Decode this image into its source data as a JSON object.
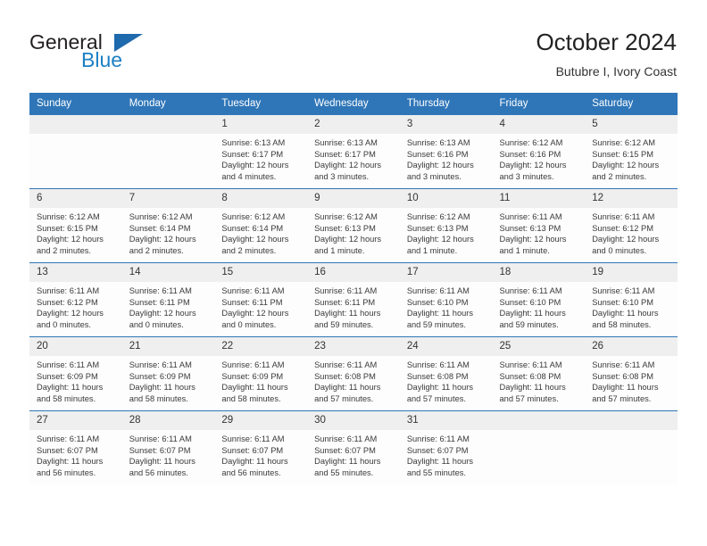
{
  "brand": {
    "name_top": "General",
    "name_bottom": "Blue",
    "triangle_icon": "triangle-icon",
    "color_dark": "#231f20",
    "color_blue": "#1c7fc4",
    "color_triangle": "#1f69ad"
  },
  "header": {
    "title": "October 2024",
    "subtitle": "Butubre I, Ivory Coast"
  },
  "theme": {
    "header_blue": "#2f76b8",
    "daynum_band": "#efefef",
    "cell_bg": "#fdfdfd",
    "text": "#3a3a3a"
  },
  "weekdays": [
    "Sunday",
    "Monday",
    "Tuesday",
    "Wednesday",
    "Thursday",
    "Friday",
    "Saturday"
  ],
  "weeks": [
    [
      {
        "day": "",
        "empty": true,
        "sunrise": "",
        "sunset": "",
        "daylight1": "",
        "daylight2": ""
      },
      {
        "day": "",
        "empty": true,
        "sunrise": "",
        "sunset": "",
        "daylight1": "",
        "daylight2": ""
      },
      {
        "day": "1",
        "sunrise": "Sunrise: 6:13 AM",
        "sunset": "Sunset: 6:17 PM",
        "daylight1": "Daylight: 12 hours",
        "daylight2": "and 4 minutes."
      },
      {
        "day": "2",
        "sunrise": "Sunrise: 6:13 AM",
        "sunset": "Sunset: 6:17 PM",
        "daylight1": "Daylight: 12 hours",
        "daylight2": "and 3 minutes."
      },
      {
        "day": "3",
        "sunrise": "Sunrise: 6:13 AM",
        "sunset": "Sunset: 6:16 PM",
        "daylight1": "Daylight: 12 hours",
        "daylight2": "and 3 minutes."
      },
      {
        "day": "4",
        "sunrise": "Sunrise: 6:12 AM",
        "sunset": "Sunset: 6:16 PM",
        "daylight1": "Daylight: 12 hours",
        "daylight2": "and 3 minutes."
      },
      {
        "day": "5",
        "sunrise": "Sunrise: 6:12 AM",
        "sunset": "Sunset: 6:15 PM",
        "daylight1": "Daylight: 12 hours",
        "daylight2": "and 2 minutes."
      }
    ],
    [
      {
        "day": "6",
        "sunrise": "Sunrise: 6:12 AM",
        "sunset": "Sunset: 6:15 PM",
        "daylight1": "Daylight: 12 hours",
        "daylight2": "and 2 minutes."
      },
      {
        "day": "7",
        "sunrise": "Sunrise: 6:12 AM",
        "sunset": "Sunset: 6:14 PM",
        "daylight1": "Daylight: 12 hours",
        "daylight2": "and 2 minutes."
      },
      {
        "day": "8",
        "sunrise": "Sunrise: 6:12 AM",
        "sunset": "Sunset: 6:14 PM",
        "daylight1": "Daylight: 12 hours",
        "daylight2": "and 2 minutes."
      },
      {
        "day": "9",
        "sunrise": "Sunrise: 6:12 AM",
        "sunset": "Sunset: 6:13 PM",
        "daylight1": "Daylight: 12 hours",
        "daylight2": "and 1 minute."
      },
      {
        "day": "10",
        "sunrise": "Sunrise: 6:12 AM",
        "sunset": "Sunset: 6:13 PM",
        "daylight1": "Daylight: 12 hours",
        "daylight2": "and 1 minute."
      },
      {
        "day": "11",
        "sunrise": "Sunrise: 6:11 AM",
        "sunset": "Sunset: 6:13 PM",
        "daylight1": "Daylight: 12 hours",
        "daylight2": "and 1 minute."
      },
      {
        "day": "12",
        "sunrise": "Sunrise: 6:11 AM",
        "sunset": "Sunset: 6:12 PM",
        "daylight1": "Daylight: 12 hours",
        "daylight2": "and 0 minutes."
      }
    ],
    [
      {
        "day": "13",
        "sunrise": "Sunrise: 6:11 AM",
        "sunset": "Sunset: 6:12 PM",
        "daylight1": "Daylight: 12 hours",
        "daylight2": "and 0 minutes."
      },
      {
        "day": "14",
        "sunrise": "Sunrise: 6:11 AM",
        "sunset": "Sunset: 6:11 PM",
        "daylight1": "Daylight: 12 hours",
        "daylight2": "and 0 minutes."
      },
      {
        "day": "15",
        "sunrise": "Sunrise: 6:11 AM",
        "sunset": "Sunset: 6:11 PM",
        "daylight1": "Daylight: 12 hours",
        "daylight2": "and 0 minutes."
      },
      {
        "day": "16",
        "sunrise": "Sunrise: 6:11 AM",
        "sunset": "Sunset: 6:11 PM",
        "daylight1": "Daylight: 11 hours",
        "daylight2": "and 59 minutes."
      },
      {
        "day": "17",
        "sunrise": "Sunrise: 6:11 AM",
        "sunset": "Sunset: 6:10 PM",
        "daylight1": "Daylight: 11 hours",
        "daylight2": "and 59 minutes."
      },
      {
        "day": "18",
        "sunrise": "Sunrise: 6:11 AM",
        "sunset": "Sunset: 6:10 PM",
        "daylight1": "Daylight: 11 hours",
        "daylight2": "and 59 minutes."
      },
      {
        "day": "19",
        "sunrise": "Sunrise: 6:11 AM",
        "sunset": "Sunset: 6:10 PM",
        "daylight1": "Daylight: 11 hours",
        "daylight2": "and 58 minutes."
      }
    ],
    [
      {
        "day": "20",
        "sunrise": "Sunrise: 6:11 AM",
        "sunset": "Sunset: 6:09 PM",
        "daylight1": "Daylight: 11 hours",
        "daylight2": "and 58 minutes."
      },
      {
        "day": "21",
        "sunrise": "Sunrise: 6:11 AM",
        "sunset": "Sunset: 6:09 PM",
        "daylight1": "Daylight: 11 hours",
        "daylight2": "and 58 minutes."
      },
      {
        "day": "22",
        "sunrise": "Sunrise: 6:11 AM",
        "sunset": "Sunset: 6:09 PM",
        "daylight1": "Daylight: 11 hours",
        "daylight2": "and 58 minutes."
      },
      {
        "day": "23",
        "sunrise": "Sunrise: 6:11 AM",
        "sunset": "Sunset: 6:08 PM",
        "daylight1": "Daylight: 11 hours",
        "daylight2": "and 57 minutes."
      },
      {
        "day": "24",
        "sunrise": "Sunrise: 6:11 AM",
        "sunset": "Sunset: 6:08 PM",
        "daylight1": "Daylight: 11 hours",
        "daylight2": "and 57 minutes."
      },
      {
        "day": "25",
        "sunrise": "Sunrise: 6:11 AM",
        "sunset": "Sunset: 6:08 PM",
        "daylight1": "Daylight: 11 hours",
        "daylight2": "and 57 minutes."
      },
      {
        "day": "26",
        "sunrise": "Sunrise: 6:11 AM",
        "sunset": "Sunset: 6:08 PM",
        "daylight1": "Daylight: 11 hours",
        "daylight2": "and 57 minutes."
      }
    ],
    [
      {
        "day": "27",
        "sunrise": "Sunrise: 6:11 AM",
        "sunset": "Sunset: 6:07 PM",
        "daylight1": "Daylight: 11 hours",
        "daylight2": "and 56 minutes."
      },
      {
        "day": "28",
        "sunrise": "Sunrise: 6:11 AM",
        "sunset": "Sunset: 6:07 PM",
        "daylight1": "Daylight: 11 hours",
        "daylight2": "and 56 minutes."
      },
      {
        "day": "29",
        "sunrise": "Sunrise: 6:11 AM",
        "sunset": "Sunset: 6:07 PM",
        "daylight1": "Daylight: 11 hours",
        "daylight2": "and 56 minutes."
      },
      {
        "day": "30",
        "sunrise": "Sunrise: 6:11 AM",
        "sunset": "Sunset: 6:07 PM",
        "daylight1": "Daylight: 11 hours",
        "daylight2": "and 55 minutes."
      },
      {
        "day": "31",
        "sunrise": "Sunrise: 6:11 AM",
        "sunset": "Sunset: 6:07 PM",
        "daylight1": "Daylight: 11 hours",
        "daylight2": "and 55 minutes."
      },
      {
        "day": "",
        "empty": true,
        "sunrise": "",
        "sunset": "",
        "daylight1": "",
        "daylight2": ""
      },
      {
        "day": "",
        "empty": true,
        "sunrise": "",
        "sunset": "",
        "daylight1": "",
        "daylight2": ""
      }
    ]
  ]
}
